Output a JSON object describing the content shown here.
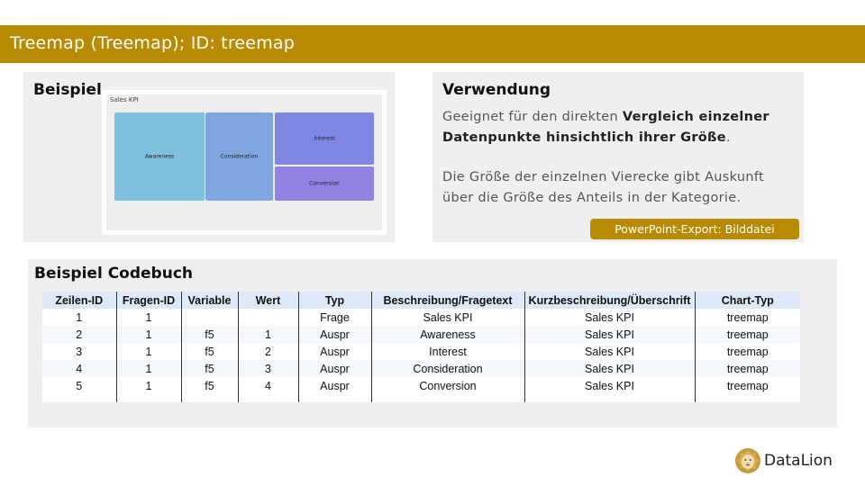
{
  "header": {
    "title": "Treemap (Treemap); ID: treemap"
  },
  "beispiel": {
    "title": "Beispiel",
    "chart_data": {
      "type": "treemap",
      "title": "Sales KPI",
      "categories": [
        "Awareness",
        "Consideration",
        "Interest",
        "Conversion"
      ],
      "colors": {
        "Awareness": "#7fbfdf",
        "Consideration": "#80a6e0",
        "Interest": "#7f87e2",
        "Conversion": "#9280e3"
      }
    }
  },
  "verwendung": {
    "title": "Verwendung",
    "para1_pre": "Geeignet für den direkten ",
    "para1_bold": "Vergleich einzelner Datenpunkte hinsichtlich ihrer Größe",
    "para1_post": ".",
    "para2": "Die Größe der einzelnen Vierecke gibt Auskunft über die Größe des Anteils in der Kategorie.",
    "export_badge": "PowerPoint-Export: Bilddatei"
  },
  "codebuch": {
    "title": "Beispiel Codebuch",
    "columns": [
      "Zeilen-ID",
      "Fragen-ID",
      "Variable",
      "Wert",
      "Typ",
      "Beschreibung/Fragetext",
      "Kurzbeschreibung/Überschrift",
      "Chart-Typ"
    ],
    "rows": [
      [
        "1",
        "1",
        "",
        "",
        "Frage",
        "Sales KPI",
        "Sales KPI",
        "treemap"
      ],
      [
        "2",
        "1",
        "f5",
        "1",
        "Auspr",
        "Awareness",
        "Sales KPI",
        "treemap"
      ],
      [
        "3",
        "1",
        "f5",
        "2",
        "Auspr",
        "Interest",
        "Sales KPI",
        "treemap"
      ],
      [
        "4",
        "1",
        "f5",
        "3",
        "Auspr",
        "Consideration",
        "Sales KPI",
        "treemap"
      ],
      [
        "5",
        "1",
        "f5",
        "4",
        "Auspr",
        "Conversion",
        "Sales KPI",
        "treemap"
      ]
    ]
  },
  "logo": {
    "text": "DataLion",
    "icon": "lion-icon",
    "brand_color": "#b88a00"
  }
}
